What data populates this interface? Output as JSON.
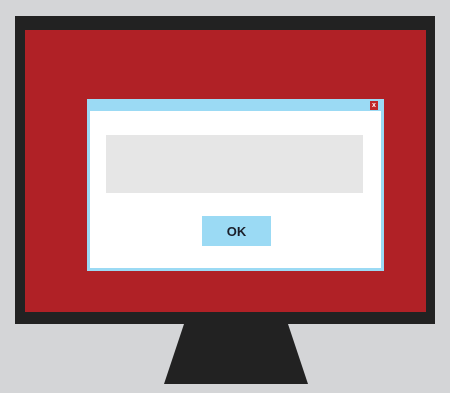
{
  "dialog": {
    "close_label": "x",
    "message": "",
    "ok_label": "OK"
  },
  "colors": {
    "background": "#d4d5d7",
    "monitor_frame": "#222222",
    "screen": "#b02126",
    "dialog_accent": "#9bdaf4",
    "close_button": "#c0292a",
    "message_box": "#e6e6e6"
  },
  "icons": {
    "close": "close-icon"
  }
}
